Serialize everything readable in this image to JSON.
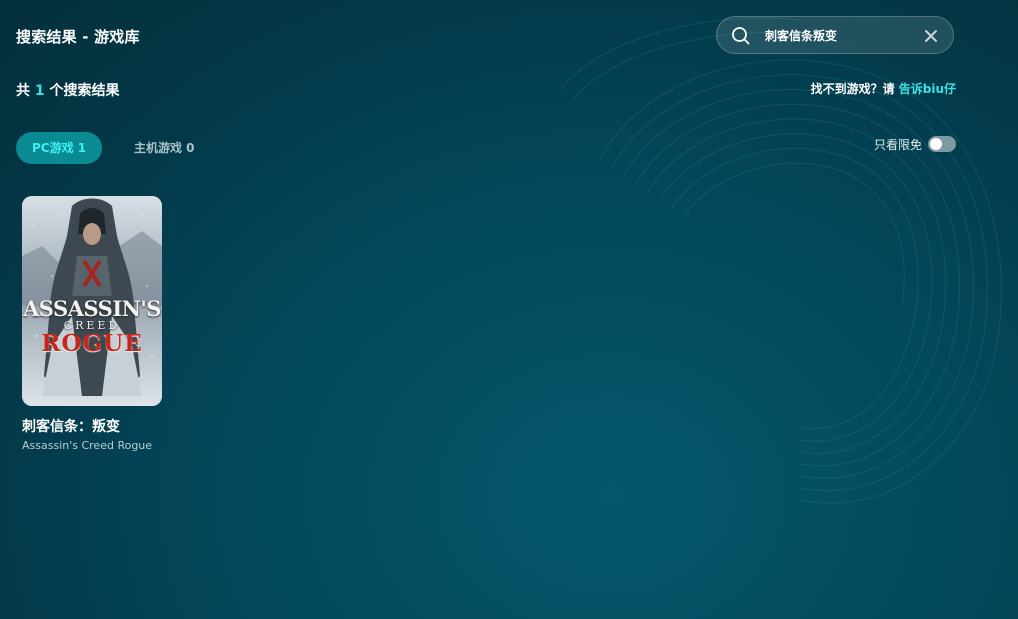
{
  "header": {
    "title": "搜索结果 - 游戏库"
  },
  "search": {
    "value": "刺客信条叛变"
  },
  "results": {
    "prefix": "共 ",
    "count": "1",
    "suffix": " 个搜索结果"
  },
  "feedback": {
    "text": "找不到游戏？请 ",
    "link_label": "告诉biu仔"
  },
  "tabs": [
    {
      "label": "PC游戏 1",
      "active": true
    },
    {
      "label": "主机游戏 0",
      "active": false
    }
  ],
  "filter": {
    "label": "只看限免",
    "on": false
  },
  "games": [
    {
      "name": "刺客信条：叛变",
      "subname": "Assassin's Creed Rogue",
      "cover_text": {
        "line1": "ASSASSIN'S",
        "line2": "CREED",
        "line3": "ROGUE"
      }
    }
  ],
  "colors": {
    "accent": "#3ee0e8",
    "tab_active_bg": "#0a8a93",
    "background": "#03475a"
  }
}
